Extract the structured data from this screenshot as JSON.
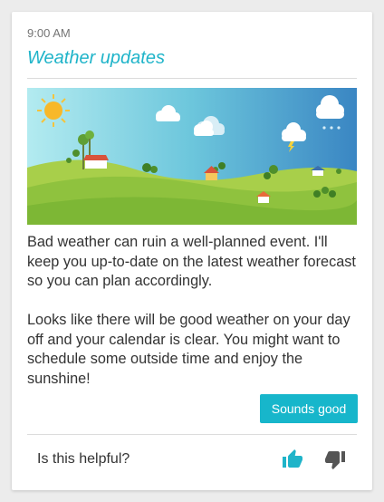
{
  "card": {
    "time": "9:00 AM",
    "title": "Weather updates",
    "paragraphs": [
      "Bad weather can ruin a well-planned event. I'll keep you up-to-date on the latest weather forecast so you can plan accordingly.",
      "Looks like there will be good weather on your day off and your calendar is clear. You might want to schedule some outside time and enjoy the sunshine!"
    ],
    "action_button": "Sounds good",
    "feedback": {
      "question": "Is this helpful?",
      "thumbs_up_icon": "thumbs-up-icon",
      "thumbs_down_icon": "thumbs-down-icon"
    }
  },
  "colors": {
    "accent": "#1fb4c9",
    "button": "#17b6cb",
    "thumbs_up": "#1fb4c9",
    "thumbs_down": "#555555"
  }
}
